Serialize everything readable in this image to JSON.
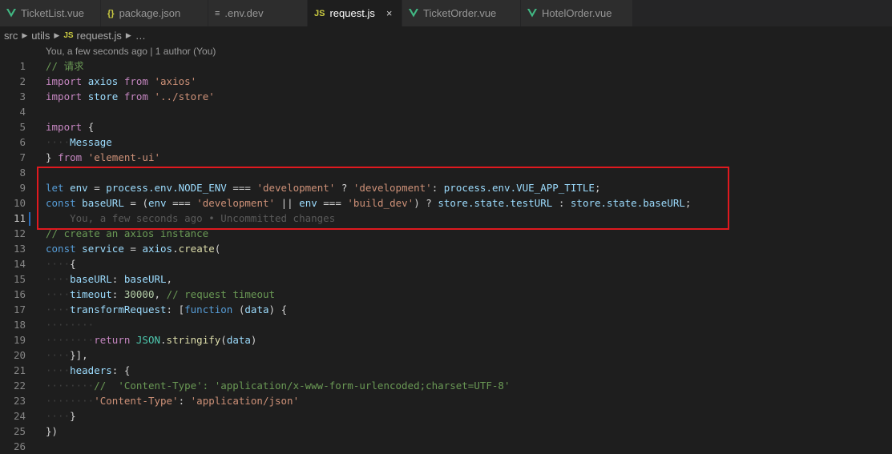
{
  "tabs": [
    {
      "label": "TicketList.vue",
      "icon": "vue-icon",
      "active": false
    },
    {
      "label": "package.json",
      "icon": "json-braces-icon",
      "icon_text": "{}",
      "active": false
    },
    {
      "label": ".env.dev",
      "icon": "lines-icon",
      "icon_text": "≡",
      "active": false
    },
    {
      "label": "request.js",
      "icon": "js-icon",
      "icon_text": "JS",
      "active": true,
      "close": "×"
    },
    {
      "label": "TicketOrder.vue",
      "icon": "vue-icon",
      "active": false
    },
    {
      "label": "HotelOrder.vue",
      "icon": "vue-icon",
      "active": false
    }
  ],
  "breadcrumb": {
    "src": "src",
    "utils": "utils",
    "js_icon": "JS",
    "file": "request.js",
    "more": "…"
  },
  "blame": "You, a few seconds ago | 1 author (You)",
  "line_numbers": [
    "1",
    "2",
    "3",
    "4",
    "5",
    "6",
    "7",
    "8",
    "9",
    "10",
    "11",
    "12",
    "13",
    "14",
    "15",
    "16",
    "17",
    "18",
    "19",
    "20",
    "21",
    "22",
    "23",
    "24",
    "25",
    "26"
  ],
  "current_line": "11",
  "code": {
    "l1_c": "// 请求",
    "l2_k": "import",
    "l2_v": "axios",
    "l2_k2": "from",
    "l2_s": "'axios'",
    "l3_k": "import",
    "l3_v": "store",
    "l3_k2": "from",
    "l3_s": "'../store'",
    "l5_k": "import",
    "l5_p": "{",
    "l6_v": "Message",
    "l7_p": "}",
    "l7_k": "from",
    "l7_s": "'element-ui'",
    "l9_k": "let",
    "l9_v": "env",
    "l9_o": "=",
    "l9_v2": "process.env.NODE_ENV",
    "l9_o2": "===",
    "l9_s1": "'development'",
    "l9_o3": "?",
    "l9_s2": "'development'",
    "l9_o4": ":",
    "l9_v3": "process.env.VUE_APP_TITLE",
    "l9_e": ";",
    "l10_k": "const",
    "l10_v": "baseURL",
    "l10_o": "=",
    "l10_p": "(",
    "l10_v2": "env",
    "l10_o2": "===",
    "l10_s1": "'development'",
    "l10_o3": "||",
    "l10_v3": "env",
    "l10_o4": "===",
    "l10_s2": "'build_dev'",
    "l10_p2": ")",
    "l10_o5": "?",
    "l10_v4": "store.state.testURL",
    "l10_o6": ":",
    "l10_v5": "store.state.baseURL",
    "l10_e": ";",
    "l11_ghost": "You, a few seconds ago • Uncommitted changes",
    "l12_c": "// create an axios instance",
    "l13_k": "const",
    "l13_v": "service",
    "l13_o": "=",
    "l13_v2": "axios",
    "l13_f": "create",
    "l13_p": "(",
    "l14_p": "{",
    "l15_v": "baseURL",
    "l15_p": ":",
    "l15_v2": "baseURL",
    "l15_e": ",",
    "l16_v": "timeout",
    "l16_p": ":",
    "l16_n": "30000",
    "l16_e": ",",
    "l16_c": "// request timeout",
    "l17_v": "transformRequest",
    "l17_p": ":",
    "l17_b": "[",
    "l17_k": "function",
    "l17_p2": "(",
    "l17_v2": "data",
    "l17_p3": ")",
    "l17_b2": "{",
    "l19_k": "return",
    "l19_c": "JSON",
    "l19_f": "stringify",
    "l19_p": "(",
    "l19_v": "data",
    "l19_p2": ")",
    "l20_p": "}],",
    "l21_v": "headers",
    "l21_p": ":",
    "l21_b": "{",
    "l22_c": "//  'Content-Type': 'application/x-www-form-urlencoded;charset=UTF-8'",
    "l23_s": "'Content-Type'",
    "l23_p": ":",
    "l23_s2": "'application/json'",
    "l24_p": "}",
    "l25_p": "})"
  },
  "colors": {
    "highlight_box": "#e0191f",
    "vue": "#41b883",
    "js": "#cbcb41",
    "json": "#cbcb41"
  }
}
